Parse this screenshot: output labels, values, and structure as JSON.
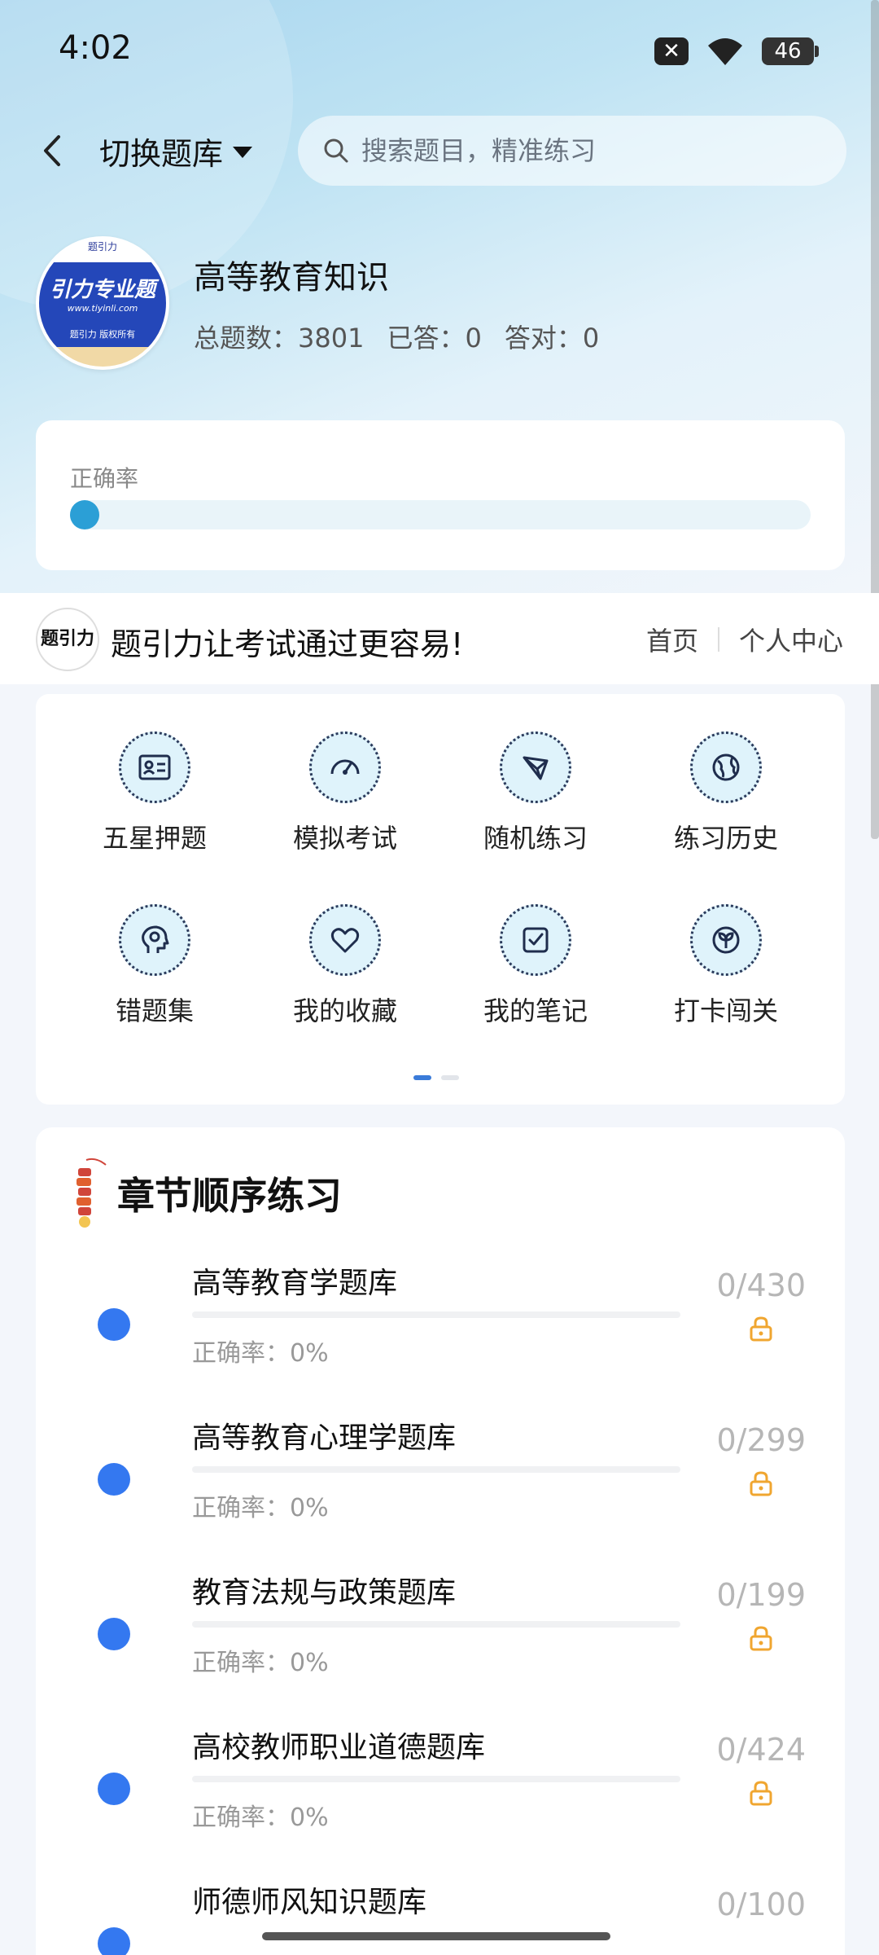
{
  "status_bar": {
    "time": "4:02",
    "battery": "46"
  },
  "header": {
    "switch_label": "切换题库",
    "search_placeholder": "搜索题目，精准练习"
  },
  "bank": {
    "logo_top": "题引力",
    "logo_main": "引力专业题",
    "logo_url": "www.tiyinli.com",
    "logo_bottom": "题引力 版权所有",
    "title": "高等教育知识",
    "stats": [
      "总题数：3801",
      "已答：0",
      "答对：0"
    ]
  },
  "accuracy": {
    "label": "正确率",
    "value": 0
  },
  "promo": {
    "logo_text": "题引力",
    "slogan": "题引力让考试通过更容易!",
    "links": [
      "首页",
      "个人中心"
    ]
  },
  "grid": {
    "items": [
      {
        "label": "五星押题",
        "icon": "id-card-icon"
      },
      {
        "label": "模拟考试",
        "icon": "speedometer-icon"
      },
      {
        "label": "随机练习",
        "icon": "shuffle-icon"
      },
      {
        "label": "练习历史",
        "icon": "globe-icon"
      },
      {
        "label": "错题集",
        "icon": "head-icon"
      },
      {
        "label": "我的收藏",
        "icon": "heart-icon"
      },
      {
        "label": "我的笔记",
        "icon": "note-check-icon"
      },
      {
        "label": "打卡闯关",
        "icon": "sprout-icon"
      }
    ],
    "page_count": 2,
    "active_page": 1
  },
  "chapters": {
    "title": "章节顺序练习",
    "items": [
      {
        "name": "高等教育学题库",
        "accuracy": "正确率：0%",
        "count": "0/430",
        "locked": true
      },
      {
        "name": "高等教育心理学题库",
        "accuracy": "正确率：0%",
        "count": "0/299",
        "locked": true
      },
      {
        "name": "教育法规与政策题库",
        "accuracy": "正确率：0%",
        "count": "0/199",
        "locked": true
      },
      {
        "name": "高校教师职业道德题库",
        "accuracy": "正确率：0%",
        "count": "0/424",
        "locked": true
      },
      {
        "name": "师德师风知识题库",
        "accuracy": "",
        "count": "0/100",
        "locked": true
      }
    ]
  },
  "colors": {
    "accent": "#3478f0",
    "lock": "#f0a630",
    "progress": "#2b9fd6"
  }
}
